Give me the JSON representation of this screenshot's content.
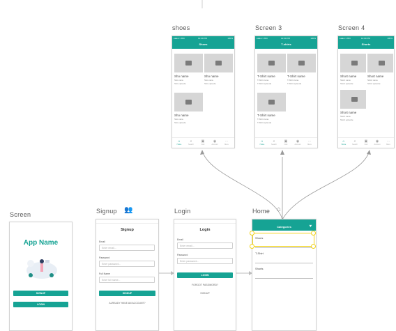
{
  "frames": {
    "shoes": {
      "title": "shoes",
      "status_left": "●●●●○ WiFi",
      "status_mid": "12:00 PM",
      "status_right": "100%",
      "appbar": "Shoes",
      "cards": [
        {
          "name": "Sho name",
          "sub1": "Sho cana",
          "sub2": "Sho episode"
        },
        {
          "name": "Sho name",
          "sub1": "Sho cana",
          "sub2": "Sho episode"
        },
        {
          "name": "Sho name",
          "sub1": "Sho cana",
          "sub2": "Sho episode"
        }
      ]
    },
    "screen3": {
      "title": "Screen 3",
      "status_left": "●●●●○ WiFi",
      "status_mid": "12:00 PM",
      "status_right": "100%",
      "appbar": "T-shirts",
      "cards": [
        {
          "name": "T-Shirt name",
          "sub1": "T-Shirt cana",
          "sub2": "T-Shirt episode"
        },
        {
          "name": "T-Shirt name",
          "sub1": "T-Shirt cana",
          "sub2": "T-Shirt episode"
        },
        {
          "name": "T-Shirt name",
          "sub1": "T-Shirt cana",
          "sub2": "T-Shirt episode"
        }
      ]
    },
    "screen4": {
      "title": "Screen 4",
      "status_left": "●●●●○ WiFi",
      "status_mid": "12:00 PM",
      "status_right": "100%",
      "appbar": "Shorts",
      "cards": [
        {
          "name": "Short name",
          "sub1": "Short cana",
          "sub2": "Short episode"
        },
        {
          "name": "Short name",
          "sub1": "Short cana",
          "sub2": "Short episode"
        },
        {
          "name": "Short name",
          "sub1": "Short cana",
          "sub2": "Short episode"
        }
      ]
    },
    "tabs": [
      "Home",
      "Search",
      "Cart",
      "Account",
      "More"
    ],
    "screen": {
      "title": "Screen",
      "app_name": "App Name",
      "signup_btn": "SIGNUP",
      "login_btn": "LOGIN"
    },
    "signup": {
      "title": "Signup",
      "heading": "Signup",
      "email_label": "Email",
      "email_placeholder": "Enter email...",
      "password_label": "Password",
      "password_placeholder": "Enter password...",
      "fullname_label": "Full Name",
      "fullname_placeholder": "Enter full name...",
      "submit": "SIGNUP",
      "link": "ALREADY HAVE AN ACCOUNT?"
    },
    "login": {
      "title": "Login",
      "heading": "Login",
      "email_label": "Email",
      "email_placeholder": "Enter email...",
      "password_label": "Password",
      "password_placeholder": "Enter password...",
      "submit": "LOGIN",
      "forgot": "FORGOT PASSWORD?",
      "signup_link": "SIGNUP"
    },
    "home": {
      "title": "Home",
      "appbar": "Categories",
      "categories": [
        "Shoes",
        "T-Shirt",
        "Shorts"
      ]
    }
  },
  "colors": {
    "accent": "#16a394",
    "selection": "#f2d31b"
  }
}
